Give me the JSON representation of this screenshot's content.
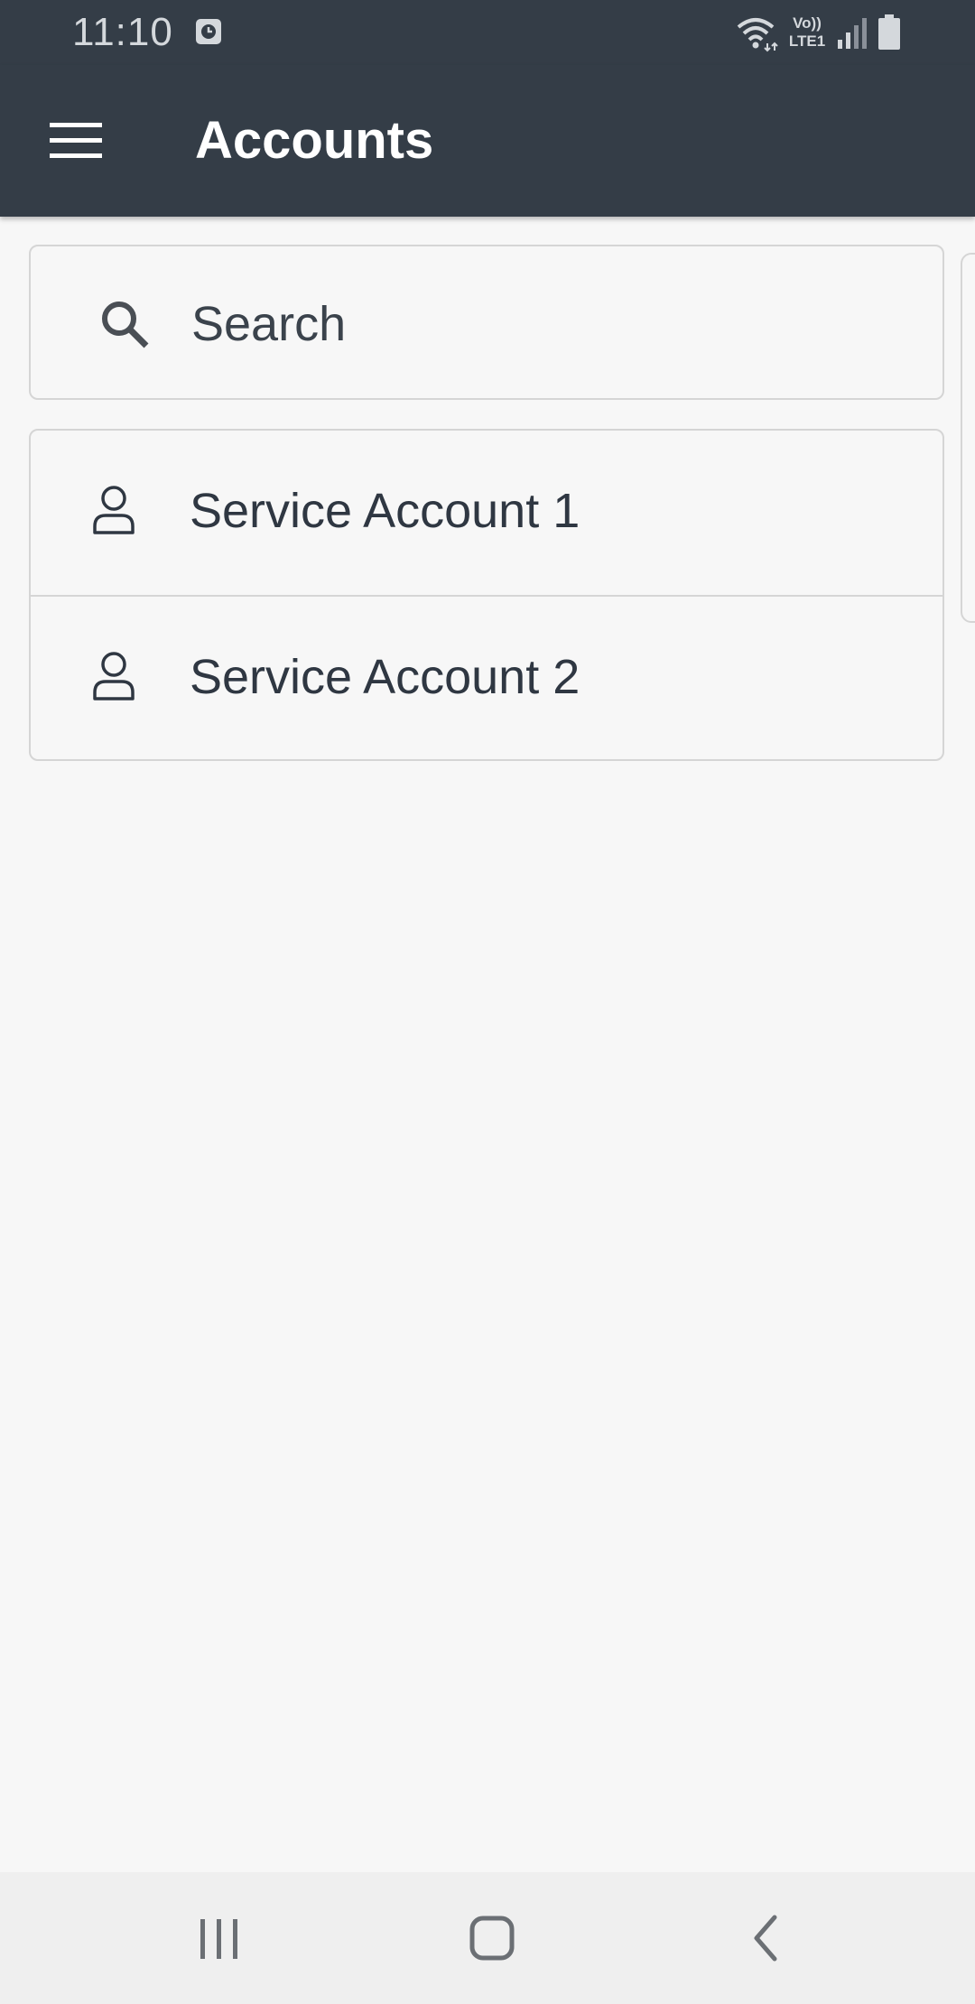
{
  "status_bar": {
    "time": "11:10",
    "lte_line1": "Vo))",
    "lte_line2": "LTE1",
    "icons": [
      "clock-badge-icon",
      "wifi-icon",
      "volte-icon",
      "signal-icon",
      "battery-icon"
    ]
  },
  "app_bar": {
    "title": "Accounts",
    "menu_icon": "hamburger-menu-icon",
    "background_color": "#343d47"
  },
  "search": {
    "placeholder": "Search",
    "value": ""
  },
  "accounts": {
    "items": [
      {
        "label": "Service Account 1",
        "icon": "user-icon"
      },
      {
        "label": "Service Account 2",
        "icon": "user-icon"
      }
    ]
  },
  "nav_bar": {
    "buttons": [
      "recents-icon",
      "home-icon",
      "back-icon"
    ]
  }
}
